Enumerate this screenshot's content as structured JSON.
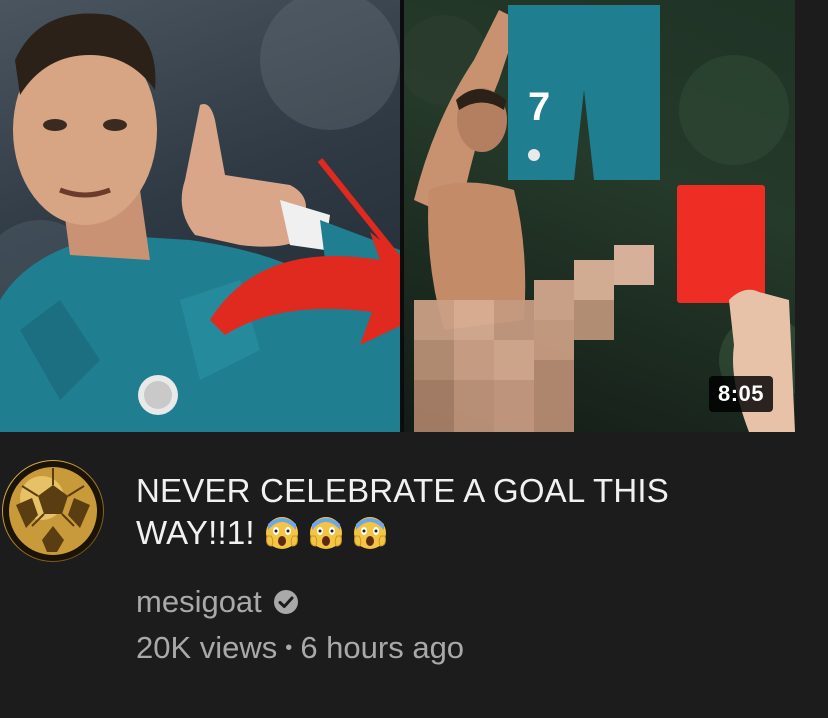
{
  "video": {
    "duration": "8:05",
    "title": "NEVER CELEBRATE A GOAL THIS WAY!!1!",
    "title_emojis": [
      "scream-emoji",
      "scream-emoji",
      "scream-emoji"
    ],
    "jersey_number": "7"
  },
  "channel": {
    "name": "mesigoat",
    "verified_icon": "check-circle-icon"
  },
  "stats": {
    "views": "20K views",
    "separator": "•",
    "age": "6 hours ago"
  },
  "colors": {
    "background": "#1c1c1c",
    "title_text": "#f1f1f1",
    "secondary_text": "#a9a9a9",
    "arrow_red": "#e02a1f",
    "red_card": "#ee2e24",
    "jersey_teal": "#1f7e8f"
  }
}
